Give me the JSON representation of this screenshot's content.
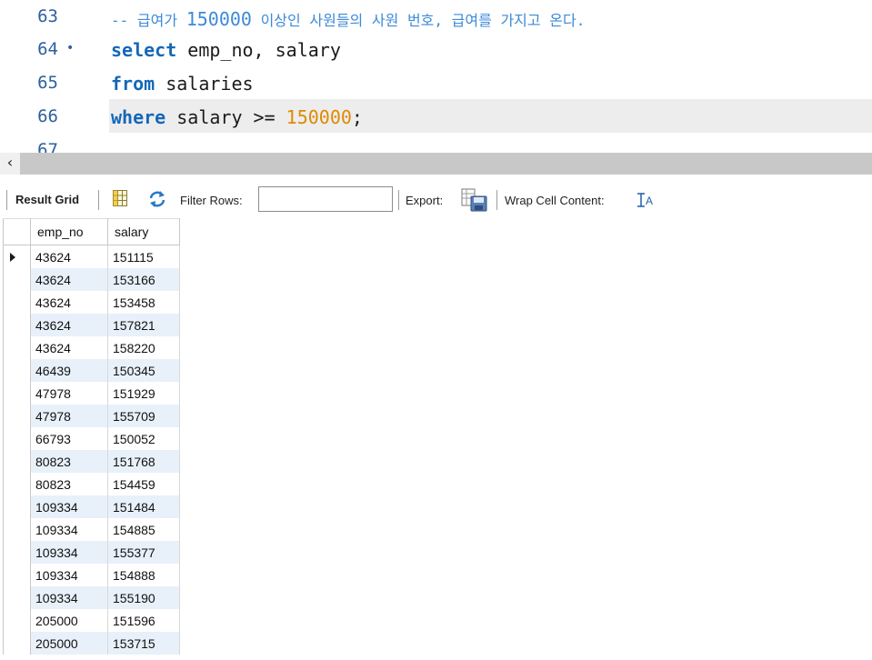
{
  "editor": {
    "lines": [
      {
        "num": "63",
        "comment_prefix": "-- 급여가 ",
        "comment_number": "150000",
        "comment_suffix": " 이상인 사원들의 사원 번호, 급여를 가지고 온다."
      },
      {
        "num": "64",
        "marker": "•",
        "kw": "select",
        "rest": " emp_no, salary"
      },
      {
        "num": "65",
        "kw": "from",
        "rest": " salaries"
      },
      {
        "num": "66",
        "kw": "where",
        "rest": " salary >= ",
        "literal": "150000",
        "tail": ";"
      },
      {
        "num": "67"
      }
    ]
  },
  "scrollbar": {
    "left_arrow": "‹"
  },
  "toolbar": {
    "tab": "Result Grid",
    "filter_label": "Filter Rows:",
    "filter_value": "",
    "export_label": "Export:",
    "wrap_label": "Wrap Cell Content:",
    "icons": [
      "grid-icon",
      "refresh-icon",
      "export-icon",
      "wrap-text-icon"
    ]
  },
  "grid": {
    "columns": [
      "emp_no",
      "salary"
    ],
    "rows": [
      [
        "43624",
        "151115"
      ],
      [
        "43624",
        "153166"
      ],
      [
        "43624",
        "153458"
      ],
      [
        "43624",
        "157821"
      ],
      [
        "43624",
        "158220"
      ],
      [
        "46439",
        "150345"
      ],
      [
        "47978",
        "151929"
      ],
      [
        "47978",
        "155709"
      ],
      [
        "66793",
        "150052"
      ],
      [
        "80823",
        "151768"
      ],
      [
        "80823",
        "154459"
      ],
      [
        "109334",
        "151484"
      ],
      [
        "109334",
        "154885"
      ],
      [
        "109334",
        "155377"
      ],
      [
        "109334",
        "154888"
      ],
      [
        "109334",
        "155190"
      ],
      [
        "205000",
        "151596"
      ],
      [
        "205000",
        "153715"
      ]
    ]
  }
}
